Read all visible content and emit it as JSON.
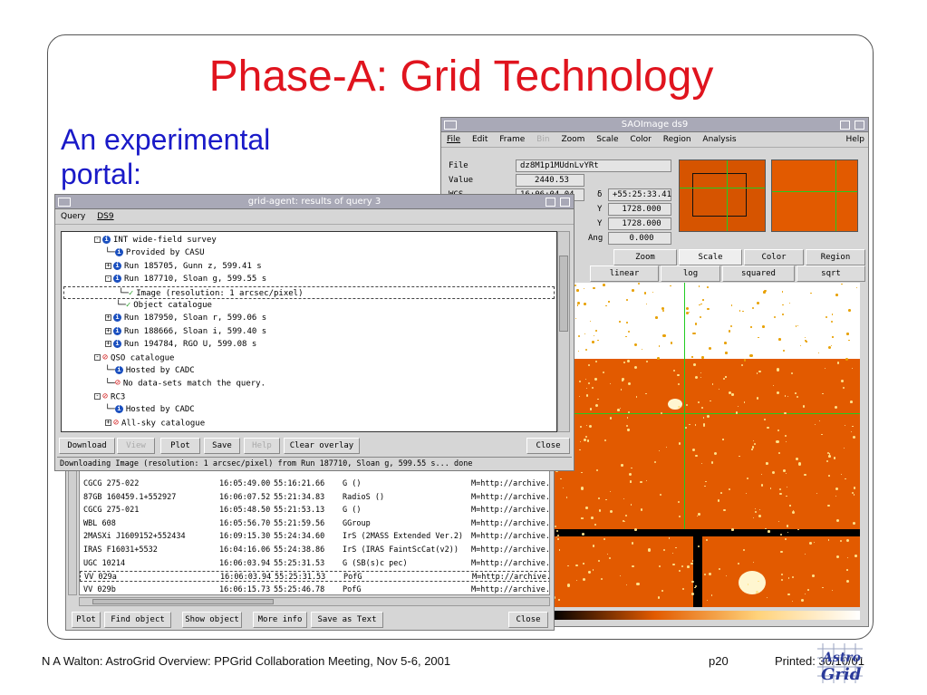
{
  "slide": {
    "title": "Phase-A: Grid Technology",
    "subtitle": "An experimental portal:"
  },
  "ds9": {
    "title": "SAOImage ds9",
    "menu": [
      "File",
      "Edit",
      "Frame",
      "Bin",
      "Zoom",
      "Scale",
      "Color",
      "Region",
      "Analysis",
      "Help"
    ],
    "info": {
      "file_label": "File",
      "file_value": "dz8M1p1MUdnLvYRt",
      "value_label": "Value",
      "value_value": "2440.53",
      "wcs_label": "WCS",
      "wcs_ra": "16:06:04.04",
      "delta": "δ",
      "wcs_dec": "+55:25:33.41",
      "y_label1": "Y",
      "y_value1": "1728.000",
      "y_label2": "Y",
      "y_value2": "1728.000",
      "ang_label": "Ang",
      "ang_value": "0.000"
    },
    "buttons1": [
      "Zoom",
      "Scale",
      "Color",
      "Region"
    ],
    "buttons2": [
      "linear",
      "log",
      "squared",
      "sqrt"
    ],
    "colors": {
      "image": "#e25a00",
      "crosshair": "#22cc22"
    }
  },
  "agent": {
    "title": "grid-agent: results of query 3",
    "menu": [
      "Query",
      "DS9"
    ],
    "tree": [
      {
        "indent": 3,
        "icon": "info",
        "exp": "-",
        "text": "INT wide-field survey"
      },
      {
        "indent": 4,
        "icon": "info",
        "exp": "",
        "text": "Provided by CASU"
      },
      {
        "indent": 4,
        "icon": "info",
        "exp": "+",
        "text": "Run 185705, Gunn z, 599.41 s"
      },
      {
        "indent": 4,
        "icon": "info",
        "exp": "-",
        "text": "Run 187710, Sloan g, 599.55 s"
      },
      {
        "indent": 5,
        "icon": "ok",
        "exp": "",
        "text": "Image (resolution: 1 arcsec/pixel)"
      },
      {
        "indent": 5,
        "icon": "ok",
        "exp": "",
        "text": "Object catalogue"
      },
      {
        "indent": 4,
        "icon": "info",
        "exp": "+",
        "text": "Run 187950, Sloan r, 599.06 s"
      },
      {
        "indent": 4,
        "icon": "info",
        "exp": "+",
        "text": "Run 188666, Sloan i, 599.40 s"
      },
      {
        "indent": 4,
        "icon": "info",
        "exp": "+",
        "text": "Run 194784, RGO U, 599.08 s"
      },
      {
        "indent": 3,
        "icon": "no",
        "exp": "-",
        "text": "QSO catalogue"
      },
      {
        "indent": 4,
        "icon": "info",
        "exp": "",
        "text": "Hosted by CADC"
      },
      {
        "indent": 4,
        "icon": "no",
        "exp": "",
        "text": "No data-sets match the query."
      },
      {
        "indent": 3,
        "icon": "no",
        "exp": "-",
        "text": "RC3"
      },
      {
        "indent": 4,
        "icon": "info",
        "exp": "",
        "text": "Hosted by CADC"
      },
      {
        "indent": 4,
        "icon": "no",
        "exp": "+",
        "text": "All-sky catalogue"
      }
    ],
    "buttons": [
      "Download",
      "View",
      "Plot",
      "Save",
      "Help",
      "Clear overlay",
      "Close"
    ],
    "status": "Downloading Image (resolution: 1 arcsec/pixel) from Run 187710, Sloan g, 599.55 s... done"
  },
  "results": {
    "rows": [
      [
        "CGCG 275-022",
        "16:05:49.00",
        "55:16:21.66",
        "G ()",
        "M=http://archive."
      ],
      [
        "87GB 160459.1+552927",
        "16:06:07.52",
        "55:21:34.83",
        "RadioS ()",
        "M=http://archive."
      ],
      [
        "CGCG 275-021",
        "16:05:48.50",
        "55:21:53.13",
        "G ()",
        "M=http://archive."
      ],
      [
        "WBL 608",
        "16:05:56.70",
        "55:21:59.56",
        "GGroup",
        "M=http://archive."
      ],
      [
        "2MASXi J1609152+552434",
        "16:09:15.30",
        "55:24:34.60",
        "IrS (2MASS Extended Ver.2)",
        "M=http://archive."
      ],
      [
        "IRAS F16031+5532",
        "16:04:16.06",
        "55:24:38.86",
        "IrS (IRAS FaintScCat(v2))",
        "M=http://archive."
      ],
      [
        "UGC 10214",
        "16:06:03.94",
        "55:25:31.53",
        "G (SB(s)c pec)",
        "M=http://archive."
      ],
      [
        "VV 029a",
        "16:06:03.94",
        "55:25:31.53",
        "PofG",
        "M=http://archive."
      ],
      [
        "VV 029b",
        "16:06:15.73",
        "55:25:46.78",
        "PofG",
        "M=http://archive."
      ]
    ],
    "buttons": [
      "Plot",
      "Find object",
      "Show object",
      "More info",
      "Save as Text",
      "Close"
    ]
  },
  "footer": {
    "left": "N A Walton: AstroGrid Overview: PPGrid Collaboration Meeting, Nov 5-6, 2001",
    "page": "p20",
    "printed": "Printed: 30/10/01",
    "logo_text": "AstroGrid"
  }
}
